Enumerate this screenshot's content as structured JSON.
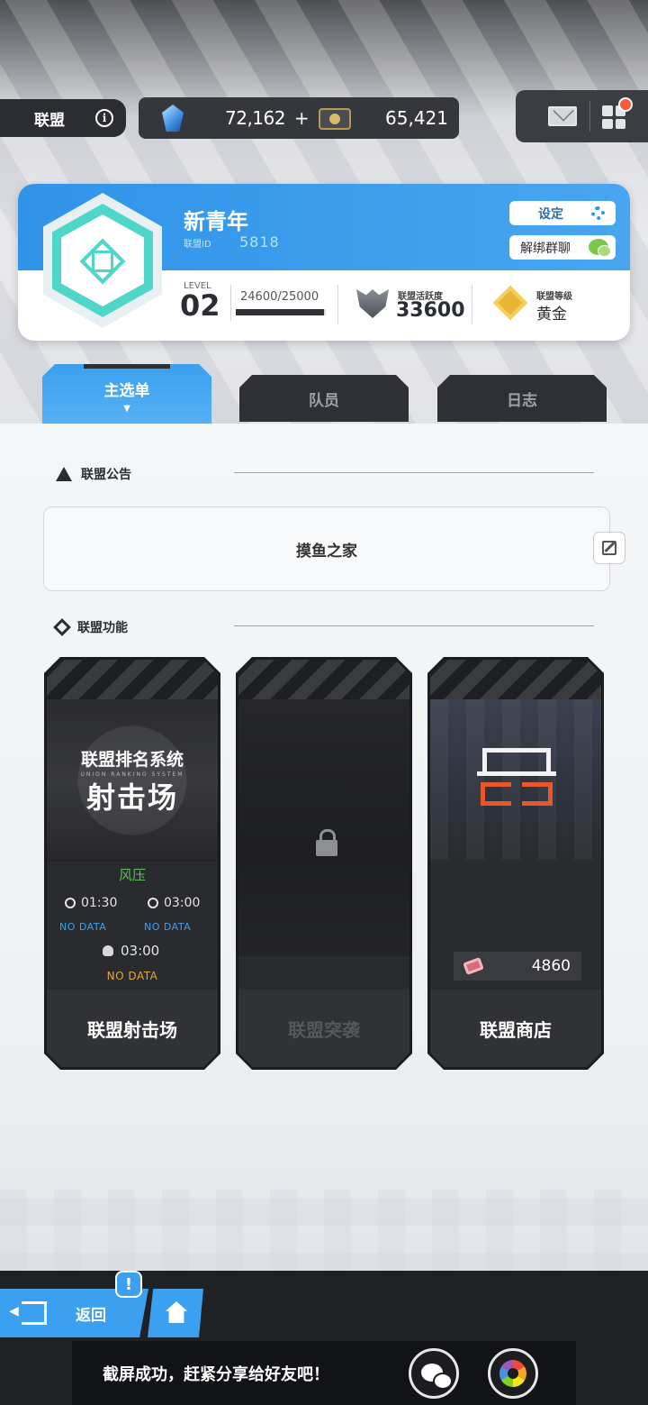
{
  "topbar": {
    "crumb_label": "联盟",
    "gems": "72,162",
    "gems_plus": "+",
    "tickets": "65,421"
  },
  "alliance": {
    "name": "新青年",
    "id_label": "联盟ID",
    "id_value": "5818",
    "settings_label": "设定",
    "unbind_label": "解绑群聊",
    "level_label": "LEVEL",
    "level_value": "02",
    "exp_text": "24600/25000",
    "exp_fraction": 0.984,
    "activity_label": "联盟活跃度",
    "activity_value": "33600",
    "rank_label": "联盟等级",
    "rank_value": "黄金"
  },
  "tabs": [
    {
      "label": "主选单",
      "arrow": "▼"
    },
    {
      "label": "队员"
    },
    {
      "label": "日志"
    }
  ],
  "notice": {
    "title": "联盟公告",
    "content": "摸鱼之家"
  },
  "features": {
    "title": "联盟功能",
    "range": {
      "art_title": "联盟排名系统",
      "art_sub": "UNION RANKING SYSTEM",
      "art_main": "射击场",
      "wind": "风压",
      "time1": "01:30",
      "time2": "03:00",
      "nodata1": "NO DATA",
      "nodata2": "NO DATA",
      "time3": "03:00",
      "nodata3": "NO DATA",
      "label": "联盟射击场"
    },
    "raid": {
      "label": "联盟突袭"
    },
    "shop": {
      "price": "4860",
      "label": "联盟商店"
    }
  },
  "bottom": {
    "back_label": "返回",
    "alert": "!",
    "toast": "截屏成功，赶紧分享给好友吧！"
  }
}
